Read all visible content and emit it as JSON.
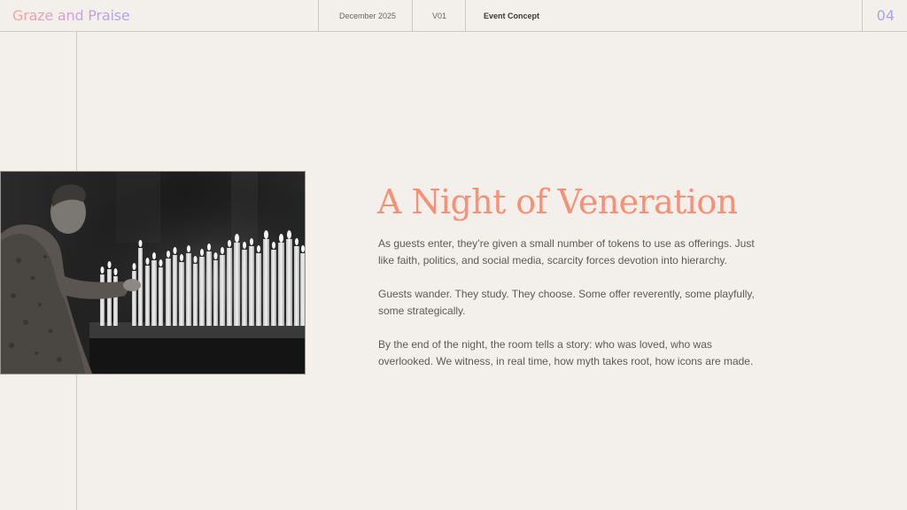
{
  "header": {
    "brand": "Graze and Praise",
    "date": "December 2025",
    "version": "V01",
    "section": "Event Concept",
    "page_number": "04"
  },
  "content": {
    "title": "A Night of Veneration",
    "paragraphs": [
      "As guests enter, they’re given a small number of tokens to use as offerings. Just like faith, politics, and social media, scarcity forces devotion into hierarchy.",
      "Guests wander. They study. They choose. Some offer reverently, some playfully, some strategically.",
      "By the end of the night, the room tells a story: who was loved, who was overlooked. We witness, in real time, how myth takes root, how icons are made."
    ]
  },
  "colors": {
    "background": "#f3efeb",
    "accent_title": "#f98f74",
    "accent_page_number": "#a9a4ee",
    "brand_gradient": [
      "#f7a39a",
      "#a9a4ee"
    ]
  }
}
